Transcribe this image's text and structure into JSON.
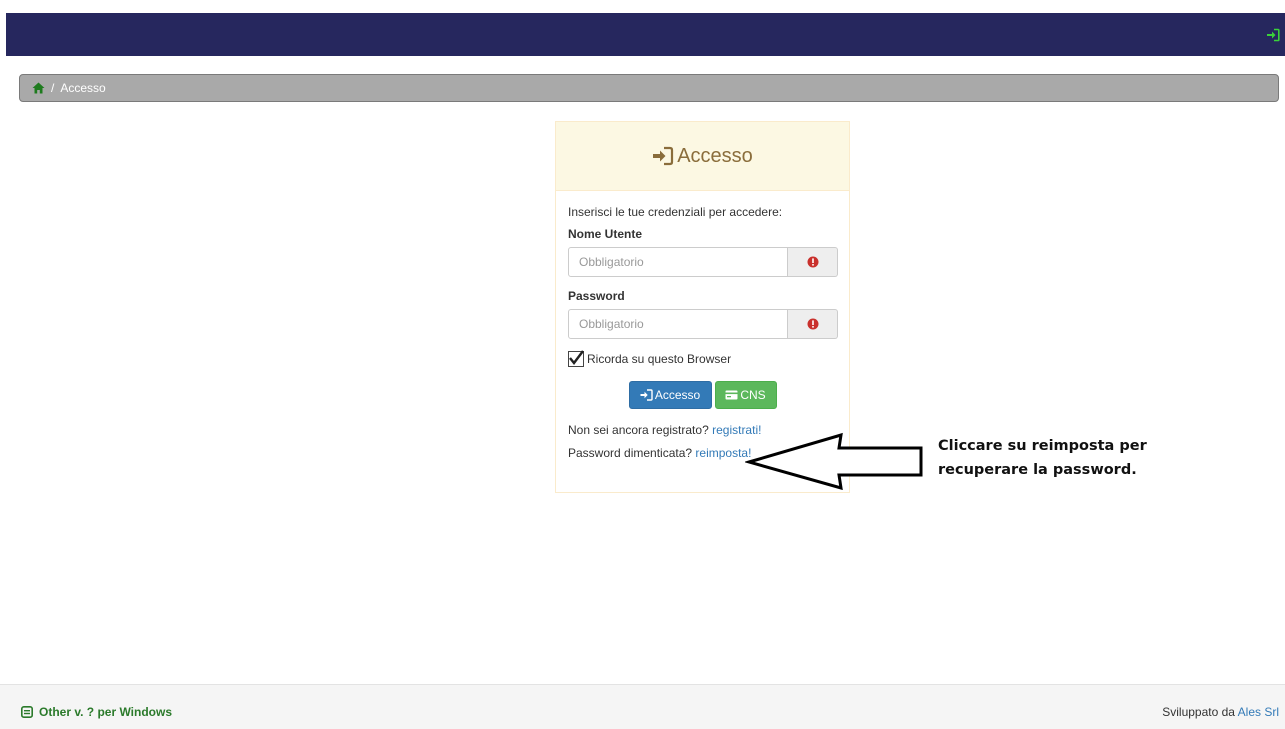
{
  "header": {
    "login_icon": "sign-in-icon"
  },
  "breadcrumb": {
    "home_icon": "home-icon",
    "separator": "/",
    "current": "Accesso"
  },
  "panel": {
    "title": "Accesso",
    "title_icon": "sign-in-icon",
    "intro": "Inserisci le tue credenziali per accedere:",
    "username_label": "Nome Utente",
    "username_placeholder": "Obbligatorio",
    "password_label": "Password",
    "password_placeholder": "Obbligatorio",
    "required_icon": "exclamation-circle-icon",
    "remember_label": "Ricorda su questo Browser",
    "remember_checked": true,
    "login_button": "Accesso",
    "cns_button": "CNS",
    "not_registered_text": "Non sei ancora registrato?",
    "register_link": "registrati!",
    "forgot_text": "Password dimenticata?",
    "reset_link": "reimposta!"
  },
  "annotation": {
    "line1": "Cliccare su reimposta per",
    "line2": "recuperare la password."
  },
  "footer": {
    "left_text": "Other v. ? per Windows",
    "left_icon": "calendar-icon",
    "right_text": "Sviluppato da",
    "right_link": "Ales Srl"
  },
  "colors": {
    "topbar": "#26275e",
    "breadcrumb": "#a9a9a9",
    "panel_heading": "#fcf8e3",
    "primary": "#337ab7",
    "success": "#5cb85c",
    "danger_icon": "#c9302c"
  }
}
